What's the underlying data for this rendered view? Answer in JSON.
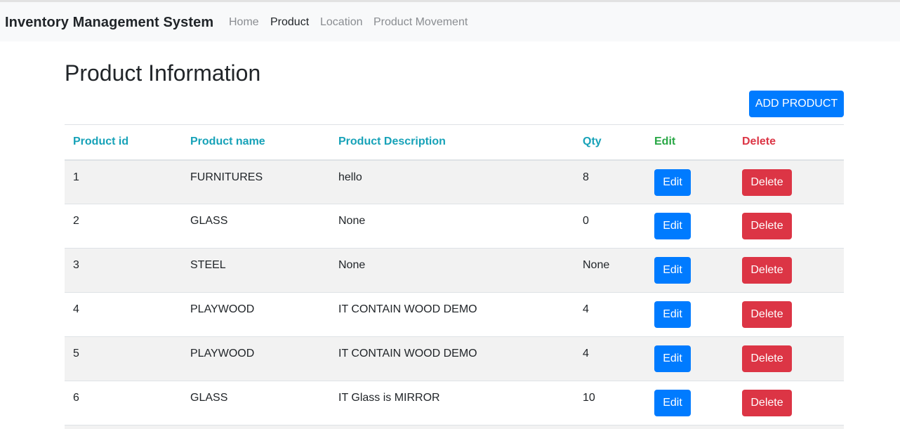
{
  "navbar": {
    "brand": "Inventory Management System",
    "links": [
      {
        "label": "Home",
        "active": false
      },
      {
        "label": "Product",
        "active": true
      },
      {
        "label": "Location",
        "active": false
      },
      {
        "label": "Product Movement",
        "active": false
      }
    ]
  },
  "page": {
    "title": "Product Information",
    "add_button": "ADD PRODUCT"
  },
  "table": {
    "headers": [
      "Product id",
      "Product name",
      "Product Description",
      "Qty",
      "Edit",
      "Delete"
    ],
    "edit_label": "Edit",
    "delete_label": "Delete",
    "rows": [
      {
        "id": "1",
        "name": "FURNITURES",
        "description": "hello",
        "qty": "8"
      },
      {
        "id": "2",
        "name": "GLASS",
        "description": "None",
        "qty": "0"
      },
      {
        "id": "3",
        "name": "STEEL",
        "description": "None",
        "qty": "None"
      },
      {
        "id": "4",
        "name": "PLAYWOOD",
        "description": "IT CONTAIN WOOD DEMO",
        "qty": "4"
      },
      {
        "id": "5",
        "name": "PLAYWOOD",
        "description": "IT CONTAIN WOOD DEMO",
        "qty": "4"
      },
      {
        "id": "6",
        "name": "GLASS",
        "description": "IT Glass is MIRROR",
        "qty": "10"
      }
    ]
  },
  "colors": {
    "primary": "#007bff",
    "danger": "#dc3545",
    "success": "#28a745",
    "info": "#17a2b8"
  }
}
